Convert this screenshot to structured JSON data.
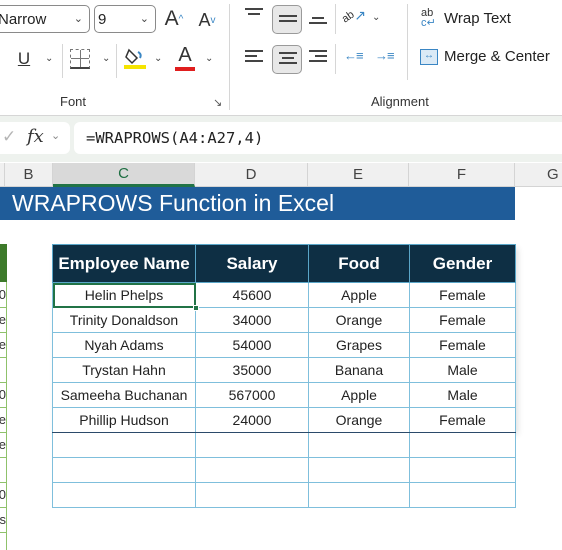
{
  "ribbon": {
    "font_name": "Narrow",
    "font_size": "9",
    "grow_font_label": "A",
    "shrink_font_label": "A",
    "underline_label": "U",
    "font_color_label": "A",
    "fill_color": "#f5e400",
    "font_color": "#e01e1e",
    "font_group_label": "Font",
    "alignment_group_label": "Alignment",
    "wrap_text_label": "Wrap Text",
    "wrap_text_icon_text": "ab",
    "merge_center_label": "Merge & Center",
    "orientation_icon_text": "ab"
  },
  "formula_bar": {
    "fx_label": "fx",
    "formula": "=WRAPROWS(A4:A27,4)"
  },
  "columns": [
    "B",
    "C",
    "D",
    "E",
    "F",
    "G"
  ],
  "selected_column": "C",
  "title": "WRAPROWS Function in Excel",
  "left_table_fragments": [
    "0",
    "e",
    "e",
    "",
    "0",
    "e",
    "e",
    "",
    "0",
    "s"
  ],
  "table": {
    "headers": [
      "Employee Name",
      "Salary",
      "Food",
      "Gender"
    ],
    "rows": [
      [
        "Helin Phelps",
        "45600",
        "Apple",
        "Female"
      ],
      [
        "Trinity Donaldson",
        "34000",
        "Orange",
        "Female"
      ],
      [
        "Nyah Adams",
        "54000",
        "Grapes",
        "Female"
      ],
      [
        "Trystan Hahn",
        "35000",
        "Banana",
        "Male"
      ],
      [
        "Sameeha Buchanan",
        "567000",
        "Apple",
        "Male"
      ],
      [
        "Phillip Hudson",
        "24000",
        "Orange",
        "Female"
      ]
    ],
    "empty_rows": 3,
    "selected_cell": "C4"
  },
  "colors": {
    "title_band": "#1f5c99",
    "table_header": "#0e2f44",
    "selection": "#217346"
  }
}
